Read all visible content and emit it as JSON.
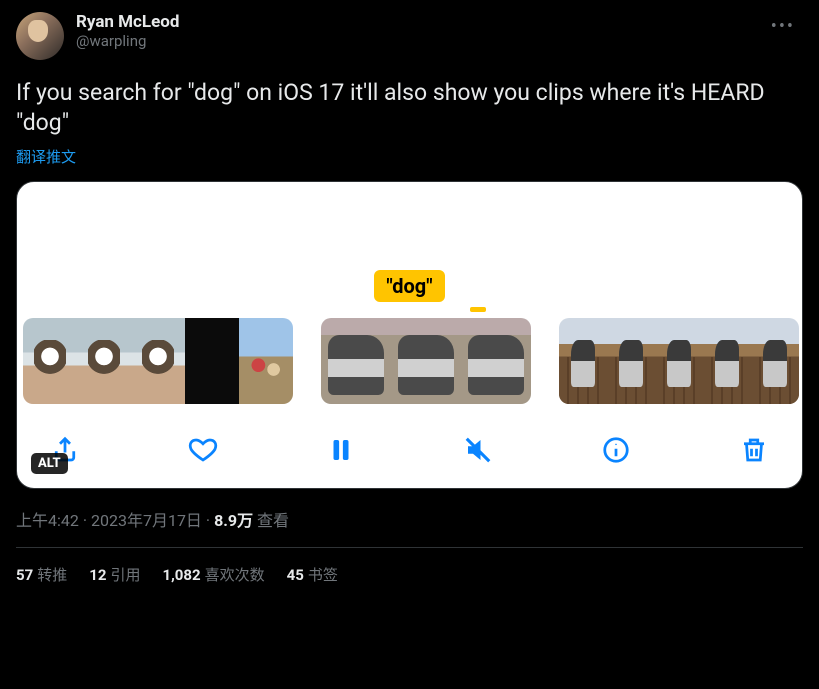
{
  "author": {
    "display_name": "Ryan McLeod",
    "handle": "@warpling"
  },
  "tweet_text": "If you search for \"dog\" on iOS 17 it'll also show you clips where it's HEARD \"dog\"",
  "translate_label": "翻译推文",
  "media": {
    "search_term_label": "\"dog\"",
    "alt_badge": "ALT",
    "toolbar_icons": {
      "share": "share-icon",
      "like": "heart-icon",
      "pause": "pause-icon",
      "mute": "mute-icon",
      "info": "info-icon",
      "delete": "trash-icon"
    }
  },
  "timestamp": {
    "time": "上午4:42",
    "sep1": " · ",
    "date": "2023年7月17日",
    "sep2": " · ",
    "views_count": "8.9万",
    "views_label": " 查看"
  },
  "stats": {
    "retweets": {
      "count": "57",
      "label": "转推"
    },
    "quotes": {
      "count": "12",
      "label": "引用"
    },
    "likes": {
      "count": "1,082",
      "label": "喜欢次数"
    },
    "bookmarks": {
      "count": "45",
      "label": "书签"
    }
  }
}
